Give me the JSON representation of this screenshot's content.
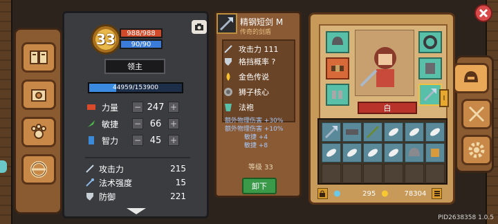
{
  "player": {
    "level": "33",
    "hp": "988/988",
    "mp": "90/90",
    "title": "领主",
    "exp_text": "44959/153900",
    "exp_fraction": 0.292
  },
  "attributes": [
    {
      "label": "力量",
      "value": "247",
      "color": "#d84a2a"
    },
    {
      "label": "敏捷",
      "value": "66",
      "color": "#4ab84a"
    },
    {
      "label": "智力",
      "value": "45",
      "color": "#3a8ad8"
    }
  ],
  "stats": [
    {
      "label": "攻击力",
      "value": "215"
    },
    {
      "label": "法术强度",
      "value": "15"
    },
    {
      "label": "防御",
      "value": "221"
    }
  ],
  "item": {
    "name": "精钢短剑 M",
    "subtitle": "传奇的剑盾",
    "props": [
      {
        "label": "攻击力 111"
      },
      {
        "label": "格挡概率 ?"
      }
    ],
    "components": [
      {
        "label": "金色传说"
      },
      {
        "label": "狮子核心"
      },
      {
        "label": "法袍"
      }
    ],
    "bonuses": [
      "额外物理伤害 +30%",
      "额外物理伤害 +10%",
      "敏捷 +4",
      "敏捷 +8"
    ],
    "grade": "等级 33",
    "unequip_label": "卸下"
  },
  "character": {
    "name": "白",
    "tab_marker": "I"
  },
  "currency": {
    "gems": "295",
    "gold": "78304"
  },
  "footer": {
    "pid": "PID2638358 1.0.5"
  },
  "colors": {
    "hp": "#d04a2a",
    "mp": "#3a7ad8",
    "equip_slot": "#58c0a8",
    "accent": "#c88848"
  }
}
